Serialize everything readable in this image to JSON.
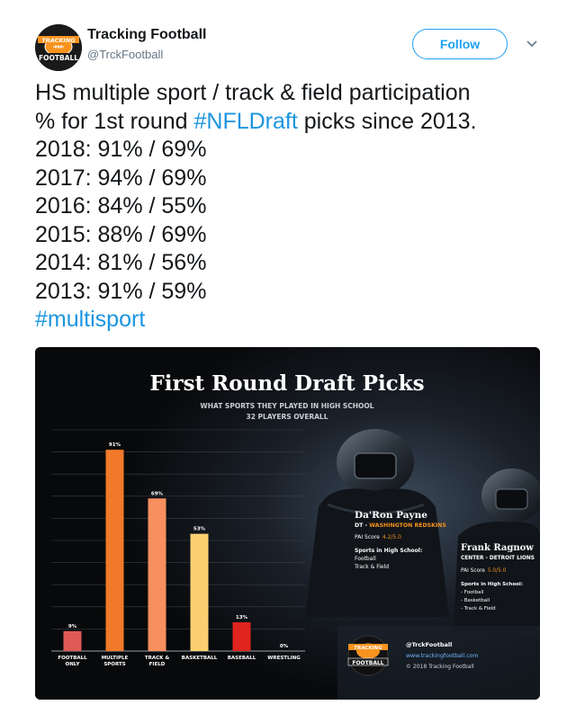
{
  "user": {
    "name": "Tracking Football",
    "handle": "@TrckFootball",
    "follow_label": "Follow"
  },
  "tweet": {
    "line1_text": "HS multiple sport / track & field participation",
    "line2_pre": "% for 1st round ",
    "line2_hashtag": "#NFLDraft",
    "line2_post": " picks since 2013.",
    "stats": [
      "2018: 91% / 69%",
      "2017: 94% / 69%",
      "2016: 84% / 55%",
      "2015: 88% / 69%",
      "2014: 81% / 56%",
      "2013: 91% / 59%"
    ],
    "hashtag2": "#multisport"
  },
  "infographic": {
    "title": "First Round Draft Picks",
    "subtitle1": "WHAT SPORTS THEY PLAYED IN HIGH SCHOOL",
    "subtitle2": "32 PLAYERS OVERALL",
    "player1": {
      "name": "Da'Ron Payne",
      "position": "DT",
      "team": "WASHINGTON REDSKINS",
      "pai_label": "PAI Score",
      "pai_value": "4.2/5.0",
      "sports_heading": "Sports in High School:",
      "sports": [
        "Football",
        "Track & Field"
      ]
    },
    "player2": {
      "name": "Frank Ragnow",
      "position": "CENTER",
      "team": "DETROIT LIONS",
      "pai_label": "PAI Score",
      "pai_value": "5.0/5.0",
      "sports_heading": "Sports in High School:",
      "sports": [
        "- Football",
        "- Basketball",
        "- Track & Field"
      ]
    },
    "footer": {
      "logo_line1": "TRACKING",
      "logo_line2": "FOOTBALL",
      "twitter": "@TrckFootball",
      "website": "www.trackingfootball.com",
      "copyright": "© 2018 Tracking Football"
    },
    "colors": {
      "football_only": "#e05a55",
      "multiple_sports": "#f07a2a",
      "track_field": "#f7905e",
      "basketball": "#fcd070",
      "baseball": "#e0241e",
      "accent_orange": "#f7931e"
    }
  },
  "chart_data": {
    "type": "bar",
    "title": "First Round Draft Picks",
    "subtitle": "WHAT SPORTS THEY PLAYED IN HIGH SCHOOL — 32 PLAYERS OVERALL",
    "categories": [
      [
        "FOOTBALL",
        "ONLY"
      ],
      [
        "MULTIPLE",
        "SPORTS"
      ],
      [
        "TRACK &",
        "FIELD"
      ],
      [
        "BASKETBALL"
      ],
      [
        "BASEBALL"
      ],
      [
        "WRESTLING"
      ]
    ],
    "values": [
      9,
      91,
      69,
      53,
      13,
      0
    ],
    "value_labels": [
      "9%",
      "91%",
      "69%",
      "53%",
      "13%",
      "0%"
    ],
    "ylim": [
      0,
      100
    ],
    "grid": true,
    "bar_colors": [
      "#e05a55",
      "#f07a2a",
      "#f7905e",
      "#fcd070",
      "#e0241e",
      "#888888"
    ]
  }
}
